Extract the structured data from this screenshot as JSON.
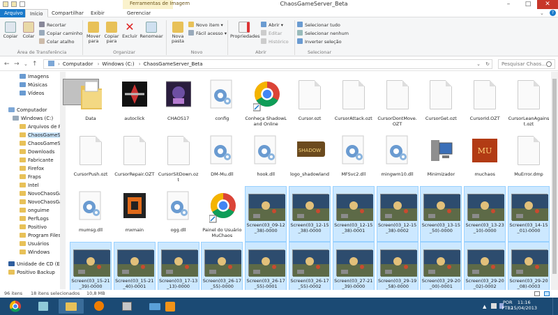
{
  "window": {
    "title": "ChaosGameServer_Beta",
    "context_group": "Ferramentas de Imagem"
  },
  "tabs": [
    "Arquivo",
    "Início",
    "Compartilhar",
    "Exibir",
    "Gerenciar"
  ],
  "ribbon": {
    "copiar": "Copiar",
    "colar": "Colar",
    "recortar": "Recortar",
    "copiar_caminho": "Copiar caminho",
    "colar_atalho": "Colar atalho",
    "area_label": "Área de Transferência",
    "mover": "Mover para",
    "copiar_para": "Copiar para",
    "excluir": "Excluir",
    "renomear": "Renomear",
    "organizar_label": "Organizar",
    "nova_pasta": "Nova pasta",
    "novo_item": "Novo item",
    "facil_acesso": "Fácil acesso",
    "novo_label": "Novo",
    "propriedades": "Propriedades",
    "abrir": "Abrir",
    "editar": "Editar",
    "historico": "Histórico",
    "abrir_label": "Abrir",
    "sel_tudo": "Selecionar tudo",
    "sel_nenhum": "Selecionar nenhum",
    "inverter": "Inverter seleção",
    "selecionar_label": "Selecionar"
  },
  "address": {
    "crumbs": [
      "Computador",
      "Windows (C:)",
      "ChaosGameServer_Beta"
    ],
    "search_placeholder": "Pesquisar Chaos..."
  },
  "nav": [
    {
      "label": "Imagens"
    },
    {
      "label": "Músicas"
    },
    {
      "label": "Vídeos"
    },
    {
      "label": "Computador"
    },
    {
      "label": "Windows (C:)"
    },
    {
      "label": "Arquivos de Pr"
    },
    {
      "label": "ChaosGameSer"
    },
    {
      "label": "ChaosGameSer"
    },
    {
      "label": "Downloads"
    },
    {
      "label": "Fabricante"
    },
    {
      "label": "Firefox"
    },
    {
      "label": "Fraps"
    },
    {
      "label": "Intel"
    },
    {
      "label": "NovoChaosGar"
    },
    {
      "label": "NovoChaosGar"
    },
    {
      "label": "onguime"
    },
    {
      "label": "PerfLogs"
    },
    {
      "label": "Positivo"
    },
    {
      "label": "Program Files ("
    },
    {
      "label": "Usuários"
    },
    {
      "label": "Windows"
    },
    {
      "label": "Unidade de CD (E"
    },
    {
      "label": "Positivo Backup"
    }
  ],
  "files": [
    {
      "name": "Data",
      "kind": "folder"
    },
    {
      "name": "autoclick",
      "kind": "app-dark"
    },
    {
      "name": "CHAOS17",
      "kind": "app-purple"
    },
    {
      "name": "config",
      "kind": "gear"
    },
    {
      "name": "Conheça ShadowLand Online",
      "kind": "chrome"
    },
    {
      "name": "Cursor.ozt",
      "kind": "doc"
    },
    {
      "name": "CursorAttack.ozt",
      "kind": "doc"
    },
    {
      "name": "CursorDontMove.OZT",
      "kind": "doc"
    },
    {
      "name": "CursorGet.ozt",
      "kind": "doc"
    },
    {
      "name": "CursorId.OZT",
      "kind": "doc"
    },
    {
      "name": "CursorLeanAgainst.ozt",
      "kind": "doc"
    },
    {
      "name": "CursorPush.ozt",
      "kind": "doc"
    },
    {
      "name": "CursorRepair.OZT",
      "kind": "doc"
    },
    {
      "name": "CursorSitDown.ozt",
      "kind": "doc"
    },
    {
      "name": "DM-Mu.dll",
      "kind": "gear"
    },
    {
      "name": "hook.dll",
      "kind": "gear"
    },
    {
      "name": "logo_shadowland",
      "kind": "logo"
    },
    {
      "name": "MFSvc2.dll",
      "kind": "gear"
    },
    {
      "name": "mingwm10.dll",
      "kind": "gear"
    },
    {
      "name": "Minimizador",
      "kind": "pc"
    },
    {
      "name": "muchaos",
      "kind": "mu"
    },
    {
      "name": "MuError.dmp",
      "kind": "doc"
    },
    {
      "name": "mumsg.dll",
      "kind": "gear"
    },
    {
      "name": "mxmain",
      "kind": "app-orange"
    },
    {
      "name": "ogg.dll",
      "kind": "gear"
    },
    {
      "name": "Painel do Usuário MuChaos",
      "kind": "chrome"
    },
    {
      "name": "Screen(03_09-12_38)-0000",
      "kind": "shot"
    },
    {
      "name": "Screen(03_12-15_38)-0000",
      "kind": "shot"
    },
    {
      "name": "Screen(03_12-15_38)-0001",
      "kind": "shot"
    },
    {
      "name": "Screen(03_12-15_38)-0002",
      "kind": "shot"
    },
    {
      "name": "Screen(03_13-15_50)-0000",
      "kind": "shot"
    },
    {
      "name": "Screen(03_13-23_10)-0000",
      "kind": "shot"
    },
    {
      "name": "Screen(03_14-15_01)-0000",
      "kind": "shot"
    },
    {
      "name": "Screen(03_15-21_39)-0000",
      "kind": "shot"
    },
    {
      "name": "Screen(03_15-21_40)-0001",
      "kind": "shot"
    },
    {
      "name": "Screen(03_17-13_13)-0000",
      "kind": "shot"
    },
    {
      "name": "Screen(03_26-17_55)-0000",
      "kind": "shot"
    },
    {
      "name": "Screen(03_26-17_55)-0001",
      "kind": "shot"
    },
    {
      "name": "Screen(03_26-17_55)-0002",
      "kind": "shot"
    },
    {
      "name": "Screen(03_27-21_39)-0000",
      "kind": "shot"
    },
    {
      "name": "Screen(03_29-19_58)-0000",
      "kind": "shot"
    },
    {
      "name": "Screen(03_29-20_00)-0001",
      "kind": "shot"
    },
    {
      "name": "Screen(03_29-20_02)-0002",
      "kind": "shot"
    },
    {
      "name": "Screen(03_29-20_08)-0003",
      "kind": "shot"
    }
  ],
  "status": {
    "count": "96 itens",
    "selected": "18 itens selecionados",
    "size": "10,8 MB"
  },
  "tray": {
    "lang": "POR",
    "layout": "PTB2",
    "time": "11:16",
    "date": "15/04/2013"
  },
  "colors": {
    "accent": "#1979ca",
    "selection": "#cce8ff",
    "taskbar": "#1b4a74"
  }
}
